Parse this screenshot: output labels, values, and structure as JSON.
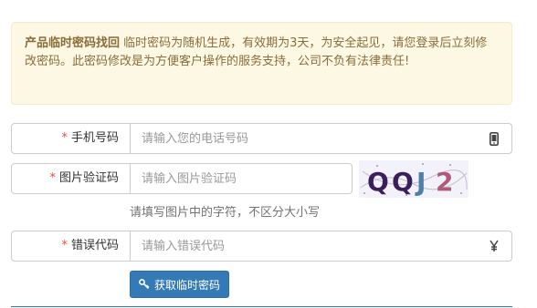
{
  "notice": {
    "title": "产品临时密码找回",
    "body": " 临时密码为随机生成，有效期为3天，为安全起见，请您登录后立刻修改密码。此密码修改是为方便客户操作的服务支持，公司不负有法律责任!"
  },
  "form": {
    "required_mark": "*",
    "phone": {
      "label": "手机号码",
      "placeholder": "请输入您的电话号码",
      "icon": "mobile-phone-icon"
    },
    "captcha": {
      "label": "图片验证码",
      "placeholder": "请输入图片验证码",
      "image_text": "QQJ2",
      "hint": "请填写图片中的字符，不区分大小写"
    },
    "error_code": {
      "label": "错误代码",
      "placeholder": "请输入错误代码",
      "icon": "yen-icon"
    },
    "submit": {
      "label": "获取临时密码",
      "icon": "key-icon"
    }
  },
  "colors": {
    "notice_bg": "#fcf8e3",
    "notice_text": "#8a6d3b",
    "required": "#e74c3c",
    "primary": "#337ab7"
  }
}
